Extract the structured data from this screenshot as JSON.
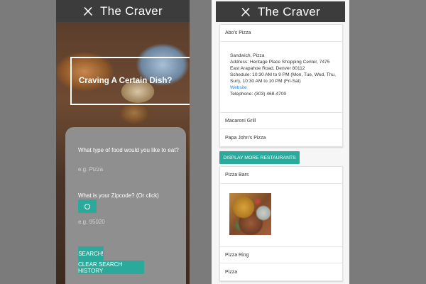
{
  "app": {
    "title": "The Craver",
    "icon": "utensils-icon"
  },
  "search": {
    "hero_heading": "Craving A Certain Dish?",
    "food_question": "What type of food would you like to eat?",
    "food_placeholder": "e.g. Pizza",
    "zip_question": "What is your Zipcode? (Or click)",
    "zip_placeholder": "e.g. 95020",
    "location_icon": "location-target-icon",
    "search_button": "SEARCH!",
    "clear_button": "CLEAR SEARCH HISTORY"
  },
  "results": {
    "group1": [
      {
        "name": "Abo's Pizza",
        "details": {
          "categories": "Sandwich, Pizza",
          "address": "Address: Heritage Place Shopping Center, 7475 East Arapahoe Road, Denver 80112",
          "schedule": "Schedule: 10:30 AM to 9 PM (Mon, Tue, Wed, Thu, Sun), 10:30 AM to 10 PM (Fri-Sat)",
          "website": "Website",
          "telephone": "Telephone: (303) 468-4700"
        }
      },
      {
        "name": "Macaroni Grill"
      },
      {
        "name": "Papa John's Pizza"
      }
    ],
    "display_more": "DISPLAY MORE RESTAURANTS",
    "group2": [
      {
        "name": "Pizza Bars"
      },
      {
        "name": "Pizza Ring"
      },
      {
        "name": "Pizza"
      }
    ]
  },
  "colors": {
    "accent": "#2ba99a",
    "topbar": "#3c3c3c",
    "background": "#7b7b7b"
  }
}
